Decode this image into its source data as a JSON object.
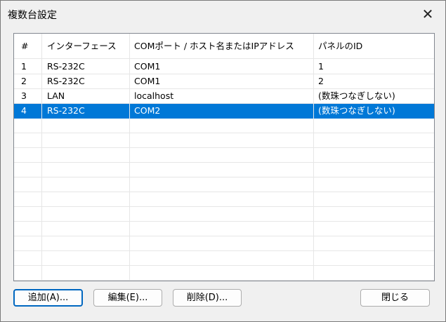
{
  "window": {
    "title": "複数台設定",
    "close_glyph": "✕"
  },
  "columns": [
    "#",
    "インターフェース",
    "COMポート / ホスト名またはIPアドレス",
    "パネルのID"
  ],
  "rows": [
    {
      "num": "1",
      "interface": "RS-232C",
      "address": "COM1",
      "panel_id": "1",
      "selected": false
    },
    {
      "num": "2",
      "interface": "RS-232C",
      "address": "COM1",
      "panel_id": "2",
      "selected": false
    },
    {
      "num": "3",
      "interface": "LAN",
      "address": "localhost",
      "panel_id": "(数珠つなぎしない)",
      "selected": false
    },
    {
      "num": "4",
      "interface": "RS-232C",
      "address": "COM2",
      "panel_id": "(数珠つなぎしない)",
      "selected": true
    }
  ],
  "buttons": {
    "add": "追加(A)...",
    "edit": "編集(E)...",
    "delete": "削除(D)...",
    "close": "閉じる"
  },
  "colors": {
    "selection": "#0078d7",
    "default_button_border": "#0067c0"
  }
}
